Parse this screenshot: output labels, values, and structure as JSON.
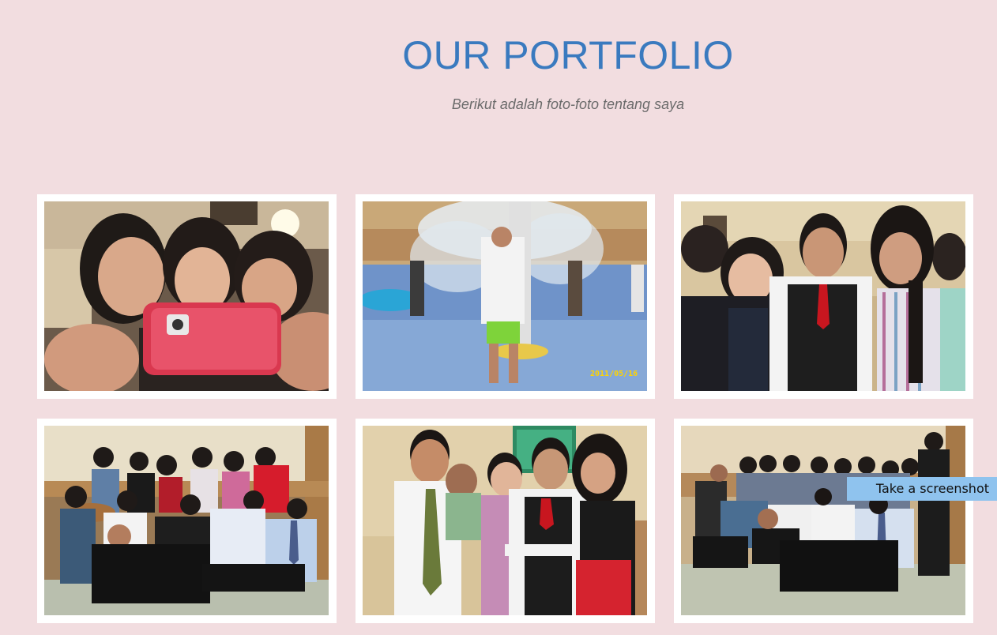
{
  "header": {
    "title": "OUR PORTFOLIO",
    "subtitle": "Berikut adalah foto-foto tentang saya"
  },
  "gallery": {
    "items": [
      {
        "image": "selfie-with-phone"
      },
      {
        "image": "water-park-fountain",
        "date_stamp": "2011/05/16"
      },
      {
        "image": "group-photo-three-people"
      },
      {
        "image": "group-photo-seated-hall"
      },
      {
        "image": "group-photo-five-people"
      },
      {
        "image": "group-photo-lounging"
      }
    ]
  },
  "tooltip": {
    "label": "Take a screenshot"
  },
  "colors": {
    "background": "#f2dde0",
    "title": "#3a7abf",
    "subtitle": "#6b6b6b",
    "frame": "#ffffff",
    "tooltip": "#8fc3ee"
  }
}
